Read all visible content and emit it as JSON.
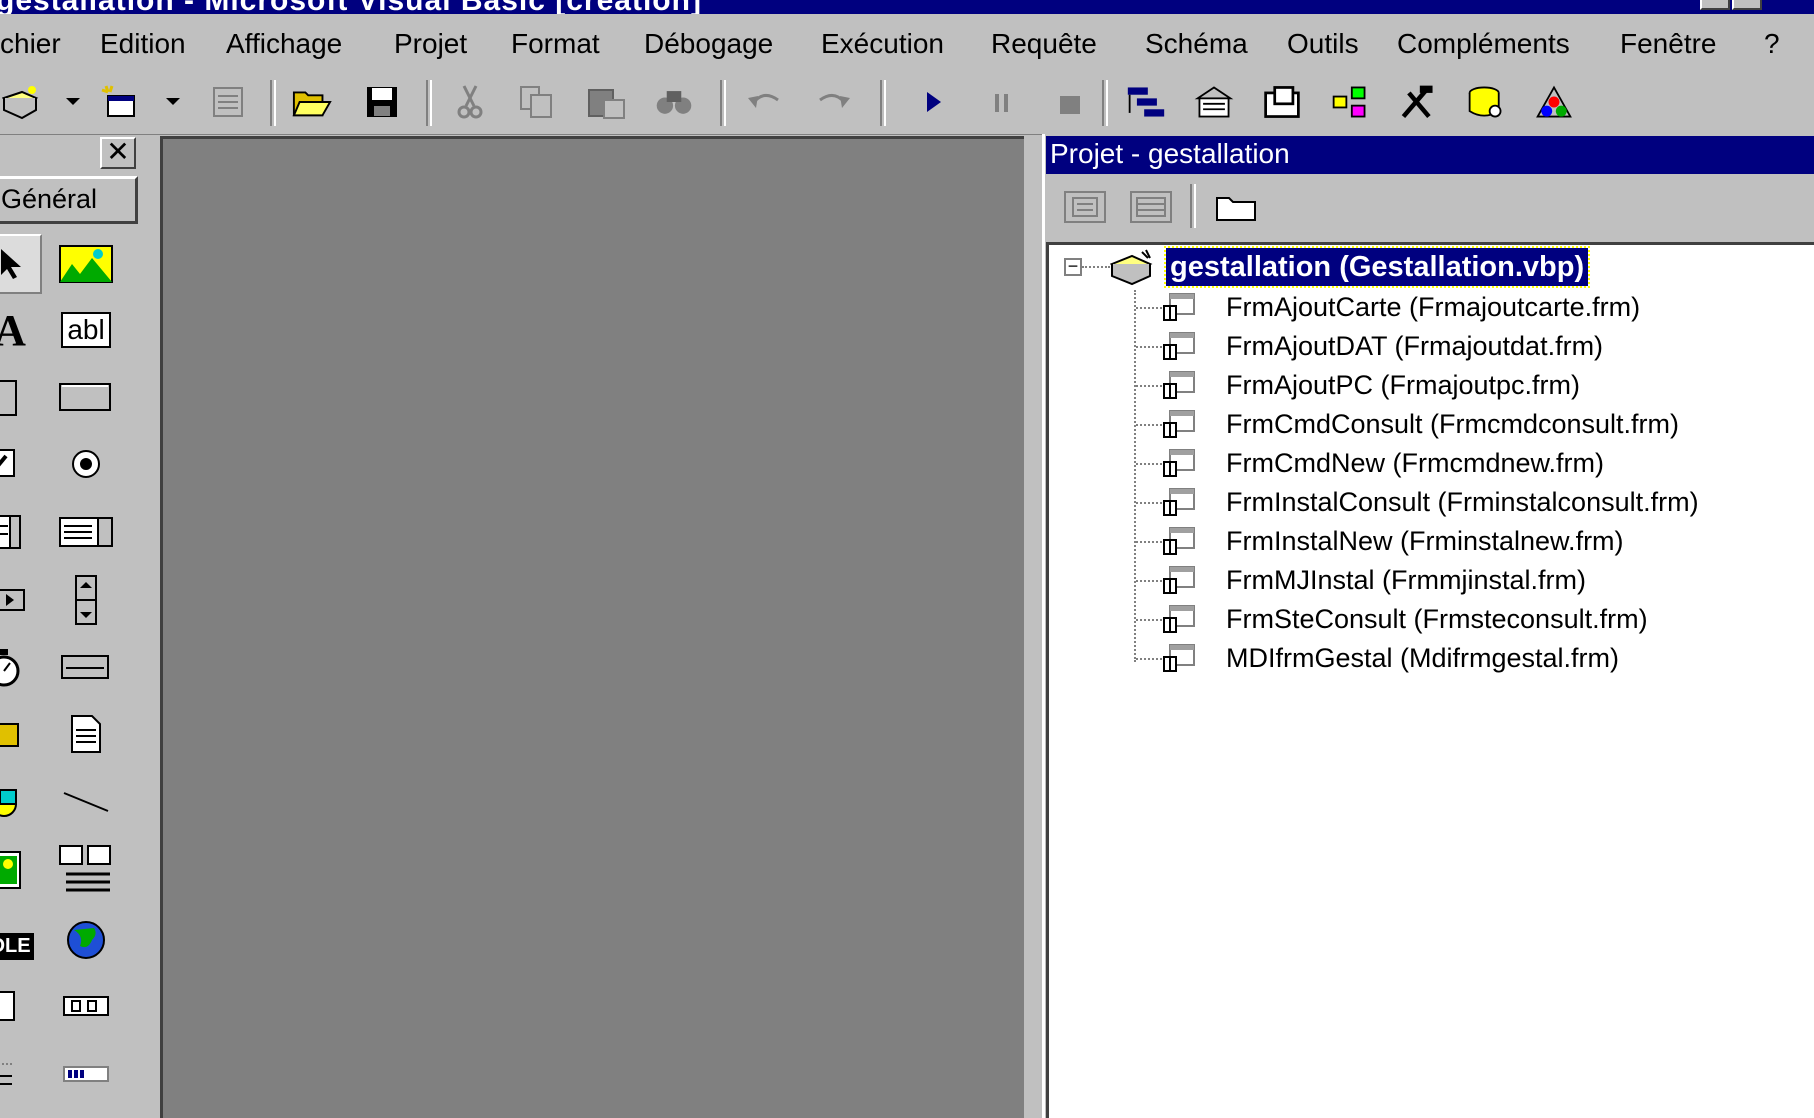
{
  "window": {
    "title": "gestallation - Microsoft Visual Basic [création]"
  },
  "menu": {
    "items": [
      "chier",
      "Edition",
      "Affichage",
      "Projet",
      "Format",
      "Débogage",
      "Exécution",
      "Requête",
      "Schéma",
      "Outils",
      "Compléments",
      "Fenêtre",
      "?"
    ]
  },
  "toolbar": {
    "icons": [
      "add-project-icon",
      "add-form-icon",
      "menu-editor-icon",
      "open-icon",
      "save-icon",
      "cut-icon",
      "copy-icon",
      "paste-icon",
      "find-icon",
      "undo-icon",
      "redo-icon",
      "run-icon",
      "pause-icon",
      "stop-icon",
      "project-explorer-icon",
      "properties-icon",
      "form-layout-icon",
      "object-browser-icon",
      "toolbox-icon",
      "data-view-icon",
      "component-manager-icon"
    ]
  },
  "toolbox": {
    "close_label": "✕",
    "tab_label": "Général",
    "tools": [
      "pointer",
      "picturebox",
      "label",
      "textbox",
      "frame",
      "commandbutton",
      "checkbox",
      "optionbutton",
      "combobox",
      "listbox",
      "hscrollbar",
      "vscrollbar",
      "timer",
      "drivelistbox",
      "dirlistbox",
      "filelistbox",
      "shape",
      "line",
      "image",
      "data",
      "ole",
      "internet",
      "generic1",
      "generic2",
      "generic3",
      "generic4"
    ],
    "image_text_ole": "OLE",
    "label_glyph": "A",
    "textbox_glyph": "abl"
  },
  "project": {
    "title": "Projet - gestallation",
    "root": "gestallation (Gestallation.vbp)",
    "forms": [
      "FrmAjoutCarte (Frmajoutcarte.frm)",
      "FrmAjoutDAT (Frmajoutdat.frm)",
      "FrmAjoutPC (Frmajoutpc.frm)",
      "FrmCmdConsult (Frmcmdconsult.frm)",
      "FrmCmdNew (Frmcmdnew.frm)",
      "FrmInstalConsult (Frminstalconsult.frm)",
      "FrmInstalNew (Frminstalnew.frm)",
      "FrmMJInstal (Frmmjinstal.frm)",
      "FrmSteConsult (Frmsteconsult.frm)",
      "MDIfrmGestal (Mdifrmgestal.frm)"
    ],
    "collapse_glyph": "−"
  },
  "colors": {
    "titlebar": "#00007f",
    "face": "#c0c0c0",
    "workspace": "#808080"
  }
}
